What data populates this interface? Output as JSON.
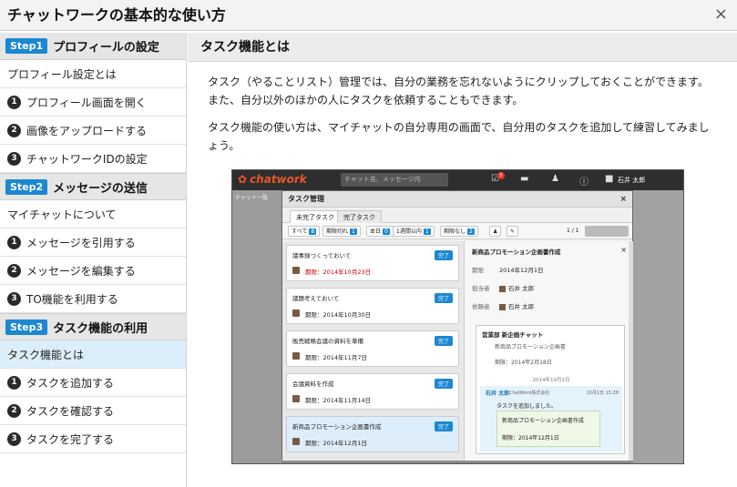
{
  "window": {
    "title": "チャットワークの基本的な使い方",
    "close_label": "×"
  },
  "sidebar": {
    "sections": [
      {
        "step": "Step1",
        "title": "プロフィールの設定",
        "items": [
          {
            "label": "プロフィール設定とは",
            "num": ""
          },
          {
            "label": "プロフィール画面を開く",
            "num": "1"
          },
          {
            "label": "画像をアップロードする",
            "num": "2"
          },
          {
            "label": "チャットワークIDの設定",
            "num": "3"
          }
        ]
      },
      {
        "step": "Step2",
        "title": "メッセージの送信",
        "items": [
          {
            "label": "マイチャットについて",
            "num": ""
          },
          {
            "label": "メッセージを引用する",
            "num": "1"
          },
          {
            "label": "メッセージを編集する",
            "num": "2"
          },
          {
            "label": "TO機能を利用する",
            "num": "3"
          }
        ]
      },
      {
        "step": "Step3",
        "title": "タスク機能の利用",
        "items": [
          {
            "label": "タスク機能とは",
            "num": ""
          },
          {
            "label": "タスクを追加する",
            "num": "1"
          },
          {
            "label": "タスクを確認する",
            "num": "2"
          },
          {
            "label": "タスクを完了する",
            "num": "3"
          }
        ]
      }
    ],
    "active_item": "タスク機能とは"
  },
  "main": {
    "heading": "タスク機能とは",
    "paragraph1": "タスク（やることリスト）管理では、自分の業務を忘れないようにクリップしておくことができます。また、自分以外のほかの人にタスクを依頼することもできます。",
    "paragraph2": "タスク機能の使い方は、マイチャットの自分専用の画面で、自分用のタスクを追加して練習してみましょう。"
  },
  "screenshot": {
    "logo_text": "chatwork",
    "search_placeholder": "チャット名、メッセージ内",
    "notif_count": "5",
    "user_name": "石井 太郎",
    "left_label": "チャット一覧",
    "modal": {
      "title": "タスク管理",
      "close": "×",
      "tabs": [
        "未完了タスク",
        "完了タスク"
      ],
      "filters": [
        {
          "label": "すべて",
          "count": "8"
        },
        {
          "label": "期限切れ",
          "count": "1"
        },
        {
          "label": "本日",
          "count": "0"
        },
        {
          "label": "1週間以内",
          "count": "1"
        },
        {
          "label": "期限なし",
          "count": "2"
        }
      ],
      "pager": "1 / 1",
      "done_label": "完了",
      "tasks": [
        {
          "title": "議事録つくっておいて",
          "due": "期限：2014年10月23日",
          "overdue": true
        },
        {
          "title": "議題考えておいて",
          "due": "期限：2014年10月30日",
          "overdue": false
        },
        {
          "title": "販売戦略会議の資料を準備",
          "due": "期限：2014年11月7日",
          "overdue": false
        },
        {
          "title": "会議資料を作成",
          "due": "期限：2014年11月14日",
          "overdue": false
        },
        {
          "title": "新商品プロモーション企画書作成",
          "due": "期限：2014年12月1日",
          "overdue": false
        }
      ],
      "detail": {
        "title": "新商品プロモーション企画書作成",
        "due_key": "期限",
        "due_value": "2014年12月1日",
        "assignee_key": "担当者",
        "assignee": "石井 太郎",
        "requester_key": "依頼者",
        "requester": "石井 太郎",
        "chat_name": "営業部 新企画チャット",
        "chat_line1": "新商品プロモーション企画書",
        "chat_line2": "期限：2014年2月18日",
        "date_sep": "2014年10月1日",
        "reply_name": "石井 太郎",
        "reply_org": "ChatWork株式会社",
        "reply_time": "10月1日 15:28",
        "reply_msg": "タスクを追加しました。",
        "reply_task": "新商品プロモーション企画書作成",
        "reply_due": "期限：2014年12月1日"
      }
    }
  }
}
